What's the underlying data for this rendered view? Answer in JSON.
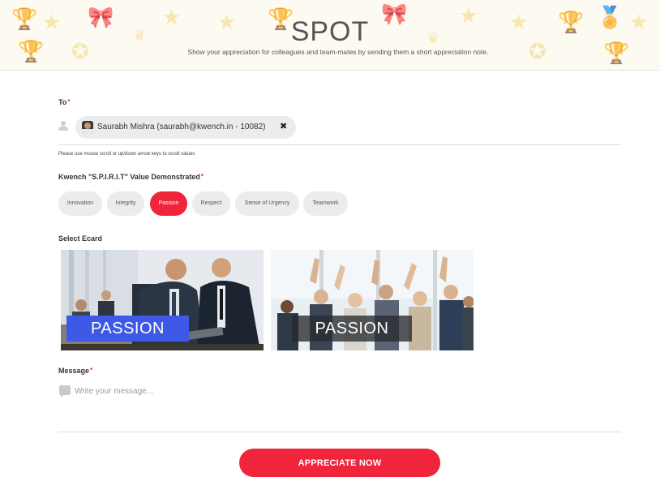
{
  "header": {
    "title": "SPOT",
    "subtitle": "Show your appreciation for colleagues and team-mates by sending them a short appreciation note."
  },
  "to": {
    "label": "To",
    "required_mark": "*",
    "recipient": "Saurabh Mishra (saurabh@kwench.in - 10082)",
    "remove_icon": "close-icon"
  },
  "hint": "Please use mouse scroll or up/down arrow keys to scroll values",
  "values": {
    "label": "Kwench \"S.P.I.R.I.T\" Value Demonstrated",
    "required_mark": "*",
    "options": [
      "Innovation",
      "Integrity",
      "Passion",
      "Respect",
      "Sense of Urgency",
      "Teamwork"
    ],
    "selected": "Passion"
  },
  "ecard": {
    "label": "Select Ecard",
    "cards": [
      {
        "caption": "PASSION"
      },
      {
        "caption": "PASSION"
      }
    ]
  },
  "message": {
    "label": "Message",
    "required_mark": "*",
    "placeholder": "Write your message..."
  },
  "submit": {
    "label": "APPRECIATE NOW"
  },
  "colors": {
    "accent": "#f0243a",
    "pill_bg": "#ececec",
    "banner_bg": "#fdfaf1"
  }
}
